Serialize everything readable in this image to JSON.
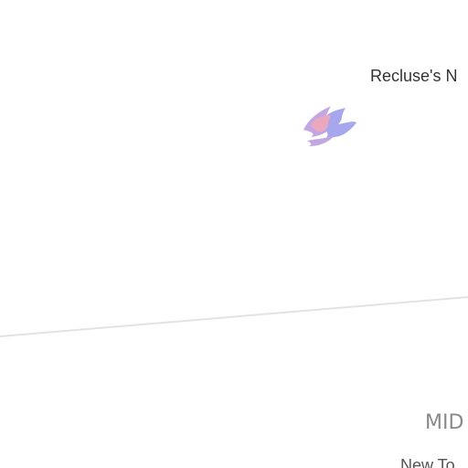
{
  "map": {
    "labels": {
      "place": "Recluse's N",
      "region": "MID",
      "town": "New To"
    },
    "marker": {
      "icon": "flame-cluster-icon",
      "colors": [
        "#e58aa8",
        "#8a8ae8",
        "#b08ad8"
      ]
    },
    "road": {
      "color": "#e3e3e3"
    },
    "background": "#ffffff"
  }
}
